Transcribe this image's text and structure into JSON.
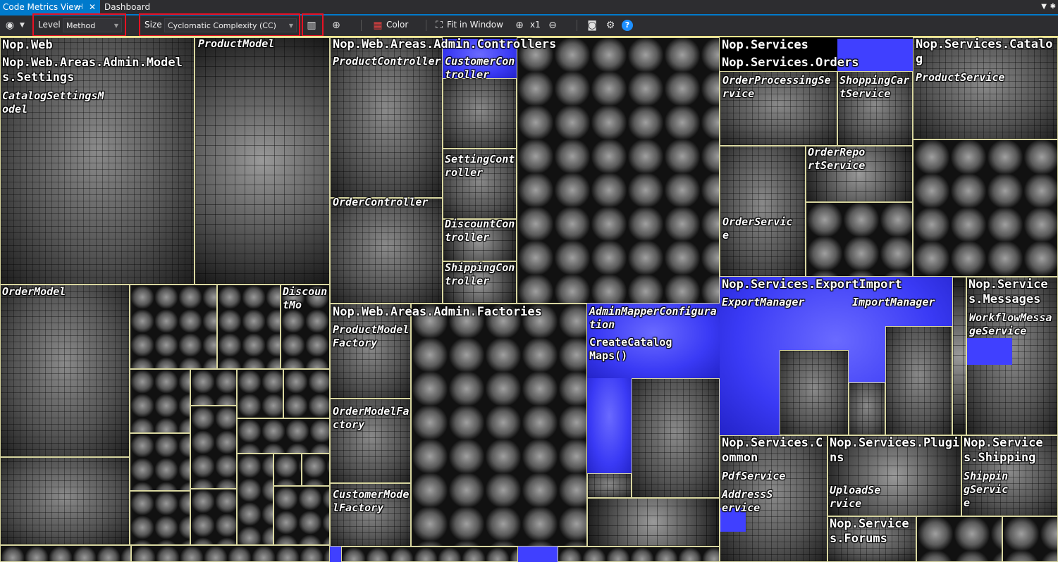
{
  "tabs": {
    "active": {
      "label": "Code Metrics View"
    },
    "inactive": {
      "label": "Dashboard"
    }
  },
  "toolbar": {
    "level_label": "Level",
    "level_value": "Method",
    "size_label": "Size",
    "size_value": "Cyclomatic Complexity (CC)",
    "color_label": "Color",
    "fit_label": "Fit in Window",
    "zoom_label": "x1"
  },
  "treemap": {
    "nop_web": "Nop.Web",
    "models_settings": "Nop.Web.Areas.Admin.Models.Settings",
    "catalog_settings": "CatalogSettingsModel",
    "product_model": "ProductModel",
    "order_model": "OrderModel",
    "discount_model": "DiscountMo",
    "admin_controllers": "Nop.Web.Areas.Admin.Controllers",
    "product_controller": "ProductController",
    "customer_controller": "CustomerController",
    "setting_controller": "SettingController",
    "order_controller": "OrderController",
    "discount_controller": "DiscountController",
    "shipping_controller": "ShippingController",
    "admin_factories": "Nop.Web.Areas.Admin.Factories",
    "product_model_factory": "ProductModelFactory",
    "order_model_factory": "OrderModelFactory",
    "customer_model_factory": "CustomerModelFactory",
    "admin_mapper": "AdminMapperConfiguration",
    "create_catalog_maps": "CreateCatalogMaps()",
    "nop_services": "Nop.Services",
    "services_orders": "Nop.Services.Orders",
    "order_processing": "OrderProcessingService",
    "shopping_cart": "ShoppingCartService",
    "order_report": "OrderReportService",
    "order_service": "OrderService",
    "services_catalog": "Nop.Services.Catalog",
    "product_service": "ProductService",
    "export_import": "Nop.Services.ExportImport",
    "export_manager": "ExportManager",
    "import_manager": "ImportManager",
    "services_messages": "Nop.Services.Messages",
    "workflow_message": "WorkflowMessageService",
    "services_common": "Nop.Services.Common",
    "pdf_service": "PdfService",
    "address_service": "AddressService",
    "services_plugins": "Nop.Services.Plugins",
    "upload_service": "UploadService",
    "services_shipping": "Nop.Services.Shipping",
    "shipping_service": "ShippingService",
    "services_forums": "Nop.Services.Forums"
  },
  "colors": {
    "accent": "#007acc",
    "highlight": "#e81123",
    "metric_high": "#4040ff"
  }
}
